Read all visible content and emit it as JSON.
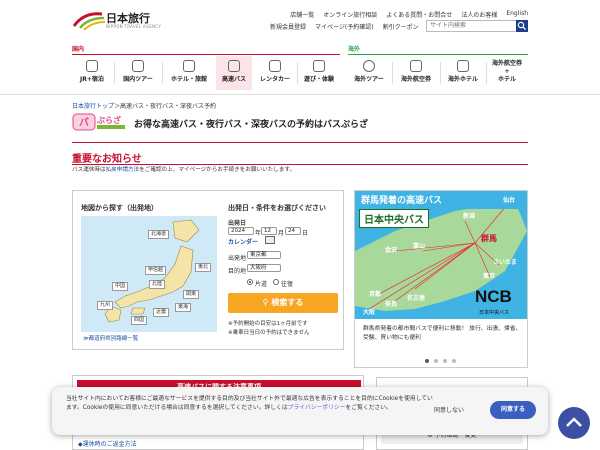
{
  "header": {
    "logo_text": "日本旅行",
    "logo_sub": "NIPPON TRAVEL AGENCY",
    "topnav_primary": [
      "店舗一覧",
      "オンライン旅行相談",
      "よくある質問・お問合せ",
      "法人のお客様",
      "English"
    ],
    "topnav_secondary": [
      "新規会員登録",
      "マイページ(予約確認)",
      "割引クーポン"
    ],
    "search_placeholder": "サイト内検索"
  },
  "catnav": {
    "domestic_label": "国内",
    "overseas_label": "海外",
    "domestic": [
      "JR+宿泊",
      "国内ツアー",
      "ホテル・旅館",
      "高速バス",
      "レンタカー",
      "遊び・体験"
    ],
    "overseas": [
      "海外ツアー",
      "海外航空券",
      "海外ホテル",
      "海外航空券\n+\nホテル"
    ]
  },
  "breadcrumb": {
    "home": "日本旅行トップ",
    "sep": "＞",
    "current": "高速バス・夜行バス・深夜バス予約"
  },
  "brand": {
    "logo_text": "バスぷらざ",
    "tagline": "お得な高速バス・夜行バス・深夜バスの予約はバスぷらざ"
  },
  "notice": {
    "title": "重要なお知らせ",
    "text_before": "バス運休時は",
    "text_link": "払戻申請方法",
    "text_after": "をご確認の上、マイページからお手続きをお願いいたします。"
  },
  "search": {
    "map_title": "地図から探す（出発地）",
    "regions": [
      "北海道",
      "東北",
      "甲信越",
      "北陸",
      "関東",
      "中国",
      "東海",
      "近畿",
      "四国",
      "九州"
    ],
    "map_link": "≫都道府県別路線一覧",
    "date_title": "出発日・条件をお選びください",
    "date_label": "出発日",
    "year": "2024",
    "year_unit": "年",
    "month": "12",
    "month_unit": "月",
    "day": "24",
    "day_unit": "日",
    "calendar": "カレンダー",
    "depart_label": "出発地",
    "depart_value": "東京都",
    "dest_label": "目的地",
    "dest_value": "大阪府",
    "oneway": "片道",
    "roundtrip": "往復",
    "search_button": "検索する",
    "note1": "※予約開始の目安は1ヶ月前です",
    "note2": "※乗車日当日の予約はできません"
  },
  "banner": {
    "headline": "群馬発着の高速バス",
    "bus_name": "日本中央バス",
    "brand": "NCB",
    "brand_sub": "日本中央バス",
    "hub": "群馬",
    "cities": [
      "仙台",
      "新潟",
      "金沢",
      "富山",
      "さいたま",
      "東京",
      "京都",
      "名古屋",
      "奈良",
      "大阪"
    ],
    "caption": "群馬県発着の都市間バスで便利に移動！ 旅行、出張、帰省、受験、買い物にも便利",
    "slides": 4,
    "active_slide": 1
  },
  "lower": {
    "left_banner": "高速バスに関する注意事項",
    "link": "◆運休時のご返金方法",
    "right_button": "予約確認・変更"
  },
  "cookie": {
    "text_before": "当社サイト内においてお客様にご最適なサービスを提供する目的及び当社サイト外で最適な広告を表示することを目的にCookieを使用しています。Cookieの使用に同意いただける場合は同意するを選択してください。詳しくは",
    "link": "プライバシーポリシー",
    "text_after": "をご覧ください。",
    "decline": "同意しない",
    "accept": "同意する"
  },
  "colors": {
    "brand_red": "#c8102e",
    "overseas_green": "#2aa74a",
    "link_blue": "#1a4fa0",
    "accent_orange": "#f6a623"
  }
}
